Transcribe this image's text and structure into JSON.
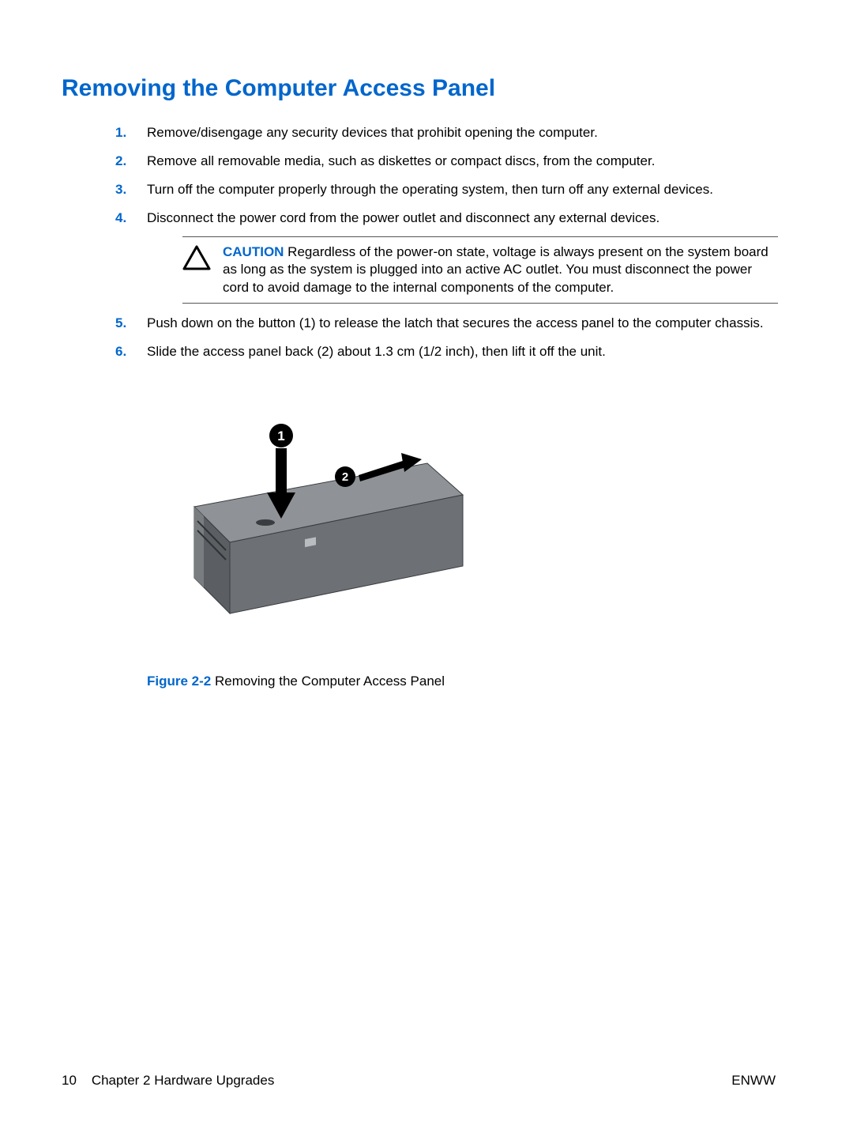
{
  "title": "Removing the Computer Access Panel",
  "steps": {
    "s1": {
      "num": "1.",
      "text": "Remove/disengage any security devices that prohibit opening the computer."
    },
    "s2": {
      "num": "2.",
      "text": "Remove all removable media, such as diskettes or compact discs, from the computer."
    },
    "s3": {
      "num": "3.",
      "text": "Turn off the computer properly through the operating system, then turn off any external devices."
    },
    "s4": {
      "num": "4.",
      "text": "Disconnect the power cord from the power outlet and disconnect any external devices."
    },
    "s5": {
      "num": "5.",
      "text": "Push down on the button (1) to release the latch that secures the access panel to the computer chassis."
    },
    "s6": {
      "num": "6.",
      "text": "Slide the access panel back (2) about 1.3 cm (1/2 inch), then lift it off the unit."
    }
  },
  "caution": {
    "label": "CAUTION",
    "text": " Regardless of the power-on state, voltage is always present on the system board as long as the system is plugged into an active AC outlet. You must disconnect the power cord to avoid damage to the internal components of the computer."
  },
  "figure": {
    "label": "Figure 2-2",
    "caption": "  Removing the Computer Access Panel",
    "callout1": "1",
    "callout2": "2"
  },
  "footer": {
    "page_number": "10",
    "chapter": "Chapter 2   Hardware Upgrades",
    "right": "ENWW"
  }
}
